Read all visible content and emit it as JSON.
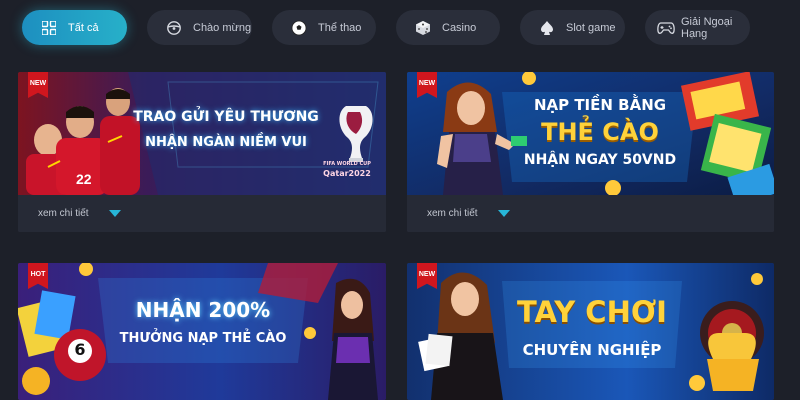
{
  "tabs": [
    {
      "label": "Tất cả",
      "icon": "grid-icon",
      "active": true
    },
    {
      "label": "Chào mừng",
      "icon": "steering-wheel-icon",
      "active": false
    },
    {
      "label": "Thể thao",
      "icon": "soccer-ball-icon",
      "active": false
    },
    {
      "label": "Casino",
      "icon": "dice-icon",
      "active": false
    },
    {
      "label": "Slot game",
      "icon": "spade-icon",
      "active": false
    },
    {
      "label": "Giải Ngoại Hạng",
      "icon": "gamepad-icon",
      "active": false
    }
  ],
  "promotions": [
    {
      "badge": "NEW",
      "line1": "TRAO GỬI YÊU THƯƠNG",
      "line2": "NHẬN NGÀN NIỀM VUI",
      "tag1": "FIFA WORLD CUP",
      "tag2": "Qatar2022",
      "link": "xem chi tiết"
    },
    {
      "badge": "NEW",
      "line1": "NẠP TIỀN BẰNG",
      "line2": "THẺ CÀO",
      "line3": "NHẬN NGAY 50VND",
      "link": "xem chi tiết"
    },
    {
      "badge": "HOT",
      "line1": "NHẬN 200%",
      "line2": "THƯỞNG NẠP THẺ CÀO",
      "ball": "6"
    },
    {
      "badge": "NEW",
      "line1": "TAY CHƠI",
      "line2": "CHUYÊN NGHIỆP"
    }
  ],
  "colors": {
    "accent": "#27b0c9",
    "badge": "#d0161e",
    "background": "#1d2029"
  }
}
